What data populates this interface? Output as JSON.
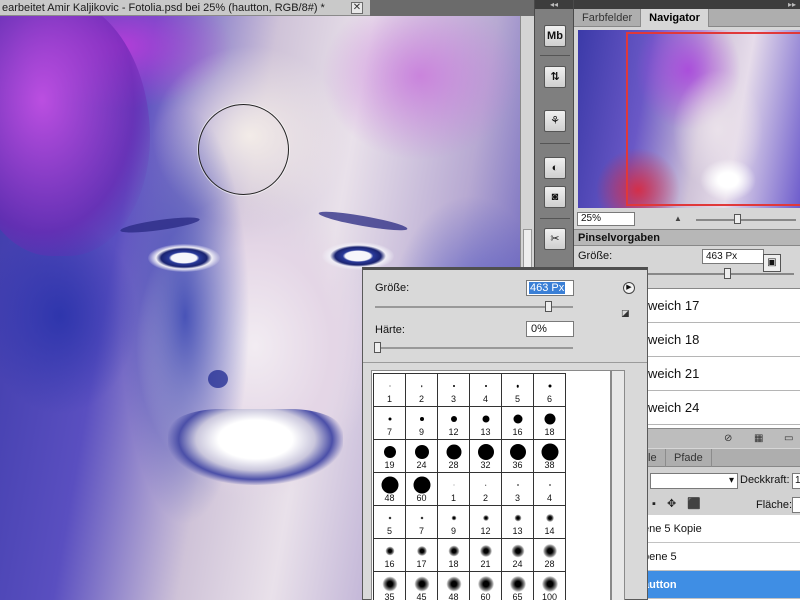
{
  "document": {
    "title": "earbeitet Amir Kaljikovic - Fotolia.psd bei 25% (hautton, RGB/8#) *",
    "close_glyph": "✕"
  },
  "dock": {
    "collapse_glyph": "◂◂",
    "buttons": [
      {
        "icon": "mini-bridge-icon",
        "label": "Mb"
      },
      {
        "icon": "history-icon",
        "label": "⇅"
      },
      {
        "icon": "actions-icon",
        "label": "⚘"
      },
      {
        "icon": "adjustments-icon",
        "label": "◐"
      },
      {
        "icon": "masks-icon",
        "label": "◙"
      },
      {
        "icon": "brush-tool-icon",
        "label": "✂"
      }
    ]
  },
  "navigator": {
    "panel_collapse_glyph": "▸▸",
    "tabs": [
      "Farbfelder",
      "Navigator"
    ],
    "active_tab": "Navigator",
    "zoom_value": "25%",
    "zoom_small_glyph": "▲",
    "frame_color": "#e0383a"
  },
  "brush_presets": {
    "title": "Pinselvorgaben",
    "size_label": "Größe:",
    "size_value": "463 Px",
    "new_preset_glyph": "▣",
    "items": [
      "weich 17",
      "weich 18",
      "weich 21",
      "weich 24"
    ],
    "footer_icons": [
      "toggle-brush-panel-icon",
      "create-new-preset-icon",
      "delete-icon"
    ],
    "footer_glyphs": [
      "⊘",
      "▦",
      "▭"
    ]
  },
  "layers": {
    "tabs": [
      "le",
      "Pfade"
    ],
    "blend_mode_glyph": "▾",
    "opacity_label": "Deckkraft:",
    "opacity_value": "1",
    "lock_glyphs": "▪ ✥ ⬛",
    "fill_label": "Fläche:",
    "rows": [
      {
        "name": "ene 5 Kopie",
        "selected": false
      },
      {
        "name": "bene 5",
        "selected": false
      },
      {
        "name": "autton",
        "selected": true
      }
    ],
    "selected_color": "#3f8ee4"
  },
  "brush_picker": {
    "size_label": "Größe:",
    "size_value": "463 Px",
    "menu_glyph": "▶",
    "reset_glyph": "◪",
    "hardness_label": "Härte:",
    "hardness_value": "0%",
    "size_slider_fraction": 0.9,
    "hardness_slider_fraction": 0.0,
    "brushes": [
      {
        "n": "1",
        "d": 1,
        "soft": false
      },
      {
        "n": "3",
        "d": 2,
        "soft": false
      },
      {
        "n": "5",
        "d": 3,
        "soft": false
      },
      {
        "n": "9",
        "d": 5,
        "soft": false
      },
      {
        "n": "13",
        "d": 7,
        "soft": false
      },
      {
        "n": "19",
        "d": 9,
        "soft": false
      },
      {
        "n": "5",
        "d": 3,
        "soft": false
      },
      {
        "n": "9",
        "d": 5,
        "soft": false
      },
      {
        "n": "13",
        "d": 7,
        "soft": false
      },
      {
        "n": "17",
        "d": 9,
        "soft": false
      },
      {
        "n": "21",
        "d": 11,
        "soft": false
      },
      {
        "n": "27",
        "d": 13,
        "soft": false
      },
      {
        "n": "35",
        "d": 16,
        "soft": false
      },
      {
        "n": "45",
        "d": 18,
        "soft": false
      },
      {
        "n": "65",
        "d": 20,
        "soft": false
      },
      {
        "n": "100",
        "d": 22,
        "soft": false
      },
      {
        "n": "200",
        "d": 22,
        "soft": false
      },
      {
        "n": "300",
        "d": 22,
        "soft": false
      },
      {
        "n": "9",
        "d": 5,
        "soft": true
      },
      {
        "n": "13",
        "d": 7,
        "soft": true
      },
      {
        "n": "19",
        "d": 9,
        "soft": true
      },
      {
        "n": "17",
        "d": 9,
        "soft": true
      },
      {
        "n": "45",
        "d": 14,
        "soft": true
      },
      {
        "n": "65",
        "d": 16,
        "soft": true
      },
      {
        "n": "100",
        "d": 18,
        "soft": true
      },
      {
        "n": "200",
        "d": 20,
        "soft": true
      },
      {
        "n": "300",
        "d": 22,
        "soft": true
      },
      {
        "n": "14",
        "d": 7,
        "soft": true
      },
      {
        "n": "24",
        "d": 9,
        "soft": true
      },
      {
        "n": "27",
        "d": 10,
        "soft": true
      },
      {
        "n": "39",
        "d": 12,
        "soft": true
      },
      {
        "n": "46",
        "d": 13,
        "soft": true
      },
      {
        "n": "59",
        "d": 15,
        "soft": true
      },
      {
        "n": "11",
        "d": 7,
        "soft": true
      },
      {
        "n": "17",
        "d": 9,
        "soft": true
      },
      {
        "n": "23",
        "d": 11,
        "soft": true
      }
    ]
  }
}
